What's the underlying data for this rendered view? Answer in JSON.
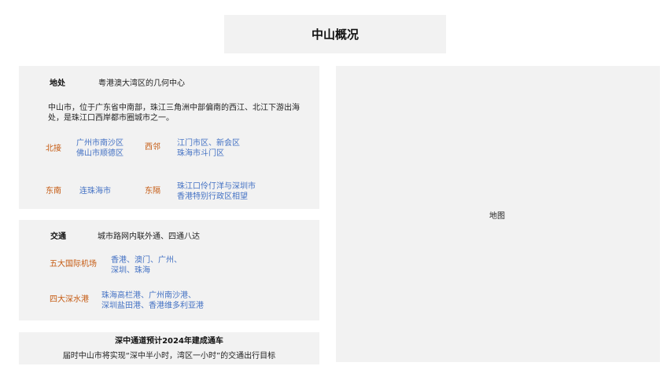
{
  "title": "中山概况",
  "location": {
    "label": "地处",
    "value": "粤港澳大湾区的几何中心",
    "description": "中山市，位于广东省中南部，珠江三角洲中部偏南的西江、北江下游出海处，是珠江口西岸都市圈城市之一。",
    "north_label": "北接",
    "north_line1": "广州市南沙区",
    "north_line2": "佛山市顺德区",
    "west_label": "西邻",
    "west_line1": "江门市区、新会区",
    "west_line2": "珠海市斗门区",
    "southeast_label": "东南",
    "southeast_value": "连珠海市",
    "east_label": "东隔",
    "east_line1": "珠江口伶仃洋与深圳市",
    "east_line2": "香港特别行政区相望"
  },
  "transport": {
    "label": "交通",
    "value": "城市路网内联外通、四通八达",
    "airports_label": "五大国际机场",
    "airports_line1": "香港、澳门、广州、",
    "airports_line2": "深圳、珠海",
    "ports_label": "四大深水港",
    "ports_line1": "珠海高栏港、广州南沙港、",
    "ports_line2": "深圳盐田港、香港维多利亚港"
  },
  "channel": {
    "heading": "深中通道预计2024年建成通车",
    "text": "届时中山市将实现“深中半小时，湾区一小时”的交通出行目标"
  },
  "map": {
    "label": "地图"
  }
}
